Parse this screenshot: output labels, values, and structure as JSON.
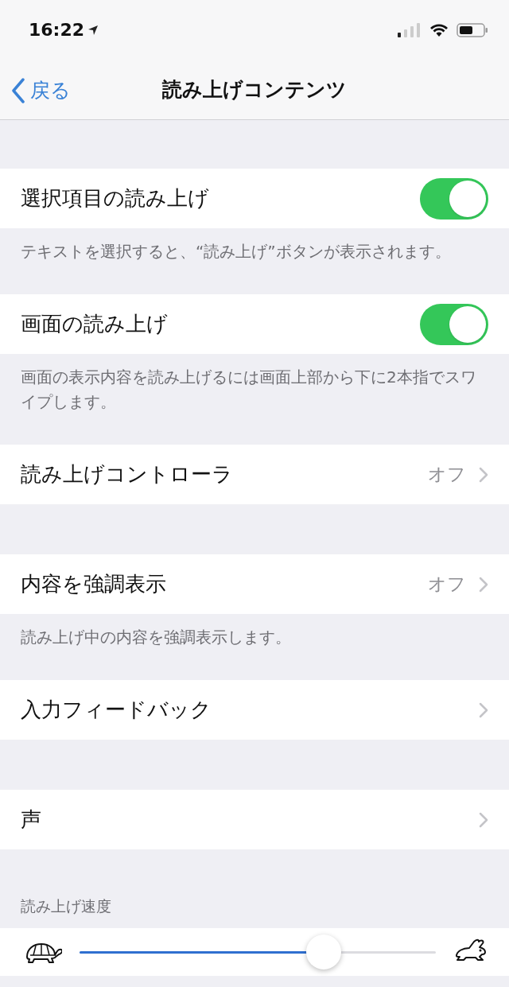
{
  "status_bar": {
    "time": "16:22"
  },
  "nav": {
    "back": "戻る",
    "title": "読み上げコンテンツ"
  },
  "sections": [
    {
      "rows": [
        {
          "kind": "toggle",
          "label": "選択項目の読み上げ",
          "on": true
        }
      ],
      "footer": "テキストを選択すると、“読み上げ”ボタンが表示されます。"
    },
    {
      "rows": [
        {
          "kind": "toggle",
          "label": "画面の読み上げ",
          "on": true
        }
      ],
      "footer": "画面の表示内容を読み上げるには画面上部から下に2本指でスワイプします。"
    },
    {
      "rows": [
        {
          "kind": "disclosure",
          "label": "読み上げコントローラ",
          "value": "オフ"
        }
      ]
    },
    {
      "rows": [
        {
          "kind": "disclosure",
          "label": "内容を強調表示",
          "value": "オフ"
        }
      ],
      "footer": "読み上げ中の内容を強調表示します。"
    },
    {
      "rows": [
        {
          "kind": "disclosure",
          "label": "入力フィードバック"
        }
      ]
    },
    {
      "rows": [
        {
          "kind": "disclosure",
          "label": "声"
        }
      ]
    },
    {
      "header": "読み上げ速度",
      "rows": [
        {
          "kind": "slider",
          "level": 0.685
        }
      ]
    }
  ]
}
